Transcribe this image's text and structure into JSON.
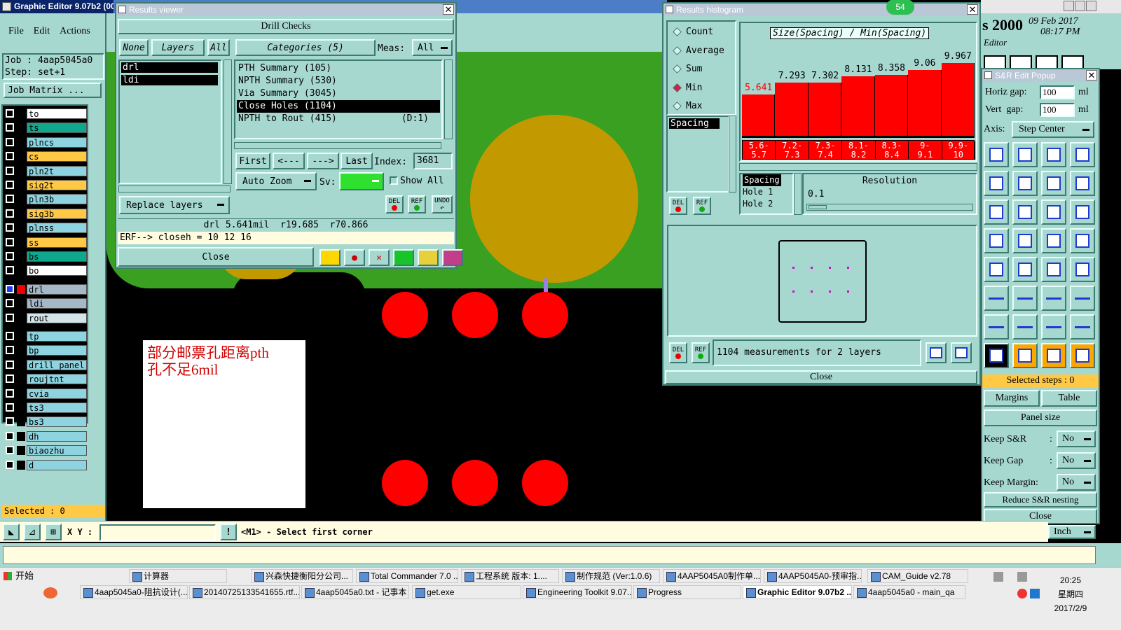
{
  "app": {
    "title": "Graphic Editor 9.07b2 (00",
    "menu": [
      "File",
      "Edit",
      "Actions"
    ],
    "job_line": "Job : 4aap5045a0",
    "step_line": "Step: set+1",
    "job_matrix": "Job Matrix ...",
    "selected": "Selected : 0"
  },
  "layers": [
    {
      "name": "to",
      "color": "#ffffff"
    },
    {
      "name": "ts",
      "color": "#0fa88c"
    },
    {
      "name": "plncs",
      "color": "#8dd3e0"
    },
    {
      "name": "cs",
      "color": "#ffc845"
    },
    {
      "name": "pln2t",
      "color": "#8dd3e0"
    },
    {
      "name": "sig2t",
      "color": "#ffc845"
    },
    {
      "name": "pln3b",
      "color": "#8dd3e0"
    },
    {
      "name": "sig3b",
      "color": "#ffc845"
    },
    {
      "name": "plnss",
      "color": "#8dd3e0"
    },
    {
      "name": "ss",
      "color": "#ffc845"
    },
    {
      "name": "bs",
      "color": "#0fa88c"
    },
    {
      "name": "bo",
      "color": "#ffffff"
    },
    {
      "name": "drl",
      "color": "#a5b8c8"
    },
    {
      "name": "ldi",
      "color": "#a5b8c8"
    },
    {
      "name": "rout",
      "color": "#d4e4e8"
    },
    {
      "name": "tp",
      "color": "#8dd3e0"
    },
    {
      "name": "bp",
      "color": "#8dd3e0"
    },
    {
      "name": "drill_panel",
      "color": "#8dd3e0"
    },
    {
      "name": "roujtnt",
      "color": "#8dd3e0"
    },
    {
      "name": "cvia",
      "color": "#8dd3e0"
    },
    {
      "name": "ts3",
      "color": "#8dd3e0"
    },
    {
      "name": "bs3",
      "color": "#8dd3e0"
    },
    {
      "name": "dh",
      "color": "#8dd3e0"
    },
    {
      "name": "biaozhu",
      "color": "#8dd3e0"
    },
    {
      "name": "d",
      "color": "#8dd3e0"
    }
  ],
  "canvas": {
    "note_text_1": "部分邮票孔距离pth",
    "note_text_2": "孔不足6mil"
  },
  "results_viewer": {
    "title": "Results viewer",
    "header": "Drill Checks",
    "tab_none": "None",
    "tab_layers": "Layers",
    "tab_all": "All",
    "categories_label": "Categories (5)",
    "meas_label": "Meas:",
    "meas_value": "All",
    "layer_list": [
      "drl",
      "ldi"
    ],
    "categories": [
      {
        "text": "PTH Summary (105)",
        "extra": ""
      },
      {
        "text": "NPTH Summary (530)",
        "extra": ""
      },
      {
        "text": "Via Summary (3045)",
        "extra": ""
      },
      {
        "text": "Close Holes (1104)",
        "extra": ""
      },
      {
        "text": "NPTH to Rout (415)",
        "extra": "(D:1)"
      }
    ],
    "first": "First",
    "prev": "<---",
    "next": "--->",
    "last": "Last",
    "index_label": "Index:",
    "index_value": "3681",
    "auto_zoom": "Auto Zoom",
    "sv_label": "Sv:",
    "show_all": "Show All",
    "replace_layers": "Replace layers",
    "del": "DEL",
    "ref": "REF",
    "undo": "UNDO",
    "measure_readout": "drl 5.641mil  r19.685  r70.866",
    "erf_line": "ERF--> closeh = 10 12 16",
    "close": "Close"
  },
  "histogram": {
    "title": "Results histogram",
    "badge": "54",
    "options": [
      "Count",
      "Average",
      "Sum",
      "Min",
      "Max"
    ],
    "selected_option": "Min",
    "list_item": "Spacing",
    "chart_title": "Size(Spacing) / Min(Spacing)",
    "del": "DEL",
    "ref": "REF",
    "spacing_box": [
      "Spacing",
      "Hole 1",
      "Hole 2"
    ],
    "resolution_label": "Resolution",
    "resolution_value": "0.1",
    "measurements": "1104 measurements for 2 layers",
    "close": "Close"
  },
  "chart_data": {
    "type": "bar",
    "title": "Size(Spacing) / Min(Spacing)",
    "categories": [
      "5.6-5.7",
      "7.2-7.3",
      "7.3-7.4",
      "8.1-8.2",
      "8.3-8.4",
      "9-9.1",
      "9.9-10"
    ],
    "values": [
      5.641,
      7.293,
      7.302,
      8.131,
      8.358,
      9.06,
      9.967
    ],
    "value_labels": [
      "5.641",
      "7.293",
      "7.302",
      "8.131",
      "8.358",
      "9.06",
      "9.967"
    ],
    "range_labels": [
      [
        "5.6-",
        "5.7"
      ],
      [
        "7.2-",
        "7.3"
      ],
      [
        "7.3-",
        "7.4"
      ],
      [
        "8.1-",
        "8.2"
      ],
      [
        "8.3-",
        "8.4"
      ],
      [
        "9-",
        "9.1"
      ],
      [
        "9.9-",
        "10"
      ]
    ],
    "ylim": [
      0,
      10
    ]
  },
  "bg_window": {
    "title_frag": "s 2000",
    "date": "09 Feb 2017",
    "time": "08:17 PM",
    "editor": "Editor"
  },
  "sr_popup": {
    "title": "S&R Edit Popup",
    "horiz_label": "Horiz gap:",
    "horiz_value": "100",
    "vert_label": "Vert  gap:",
    "vert_value": "100",
    "unit": "ml",
    "axis_label": "Axis:",
    "axis_value": "Step Center",
    "selected_steps": "Selected steps : 0",
    "margins": "Margins",
    "table": "Table",
    "panel_size": "Panel size",
    "keep_sr": "Keep S&R",
    "keep_gap": "Keep Gap",
    "keep_margin": "Keep Margin:",
    "colon": ":",
    "no": "No",
    "reduce": "Reduce S&R nesting",
    "close": "Close",
    "inch": "Inch"
  },
  "status_bar": {
    "xy_label": "X Y :",
    "prompt": "<M1> - Select first corner"
  },
  "taskbar": {
    "start": "开始",
    "row1": [
      "计算器",
      "兴森快捷衡阳分公司...",
      "Total Commander 7.0 ...",
      "工程系统  版本: 1....",
      "制作规范 (Ver:1.0.6)",
      "4AAP5045A0制作单....",
      "4AAP5045A0-预审指...",
      "CAM_Guide v2.78"
    ],
    "row2": [
      "4aap5045a0-阻抗设计(...",
      "20140725133541655.rtf...",
      "4aap5045a0.txt - 记事本",
      "get.exe",
      "Engineering Toolkit 9.07...",
      "Progress",
      "Graphic Editor 9.07b2 ...",
      "4aap5045a0 - main_qa"
    ],
    "clock_time": "20:25",
    "clock_day": "星期四",
    "clock_date": "2017/2/9"
  }
}
